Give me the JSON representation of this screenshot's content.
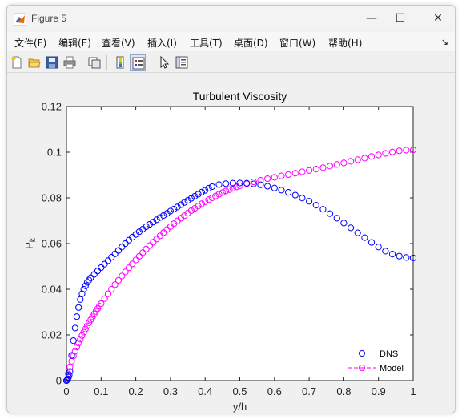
{
  "window": {
    "title": "Figure 5",
    "controls": {
      "minimize": "—",
      "maximize": "☐",
      "close": "✕"
    }
  },
  "menu": {
    "items": [
      "文件(F)",
      "编辑(E)",
      "查看(V)",
      "插入(I)",
      "工具(T)",
      "桌面(D)",
      "窗口(W)",
      "帮助(H)"
    ],
    "overflow_arrow": "↘"
  },
  "toolbar": {
    "icons": [
      "new-figure-icon",
      "open-file-icon",
      "save-icon",
      "print-icon",
      "link-plot-icon",
      "insert-colorbar-icon",
      "insert-legend-icon",
      "pointer-icon",
      "property-inspector-icon"
    ]
  },
  "colors": {
    "dns": "#0000ff",
    "model": "#ff00ff"
  },
  "chart_data": {
    "type": "scatter",
    "title": "Turbulent Viscosity",
    "xlabel": "y/h",
    "ylabel": "P",
    "ylabel_subscript": "k",
    "xlim": [
      0,
      1
    ],
    "ylim": [
      0,
      0.12
    ],
    "x_ticks": [
      "0",
      "0.1",
      "0.2",
      "0.3",
      "0.4",
      "0.5",
      "0.6",
      "0.7",
      "0.8",
      "0.9",
      "1"
    ],
    "y_ticks": [
      "0",
      "0.02",
      "0.04",
      "0.06",
      "0.08",
      "0.1",
      "0.12"
    ],
    "grid": false,
    "legend_position": "bottom-right",
    "series": [
      {
        "name": "DNS",
        "marker": "circle",
        "line": "none",
        "x": [
          0.0,
          0.002,
          0.004,
          0.006,
          0.008,
          0.01,
          0.015,
          0.02,
          0.025,
          0.03,
          0.035,
          0.04,
          0.045,
          0.05,
          0.055,
          0.06,
          0.065,
          0.07,
          0.08,
          0.09,
          0.1,
          0.11,
          0.12,
          0.13,
          0.14,
          0.15,
          0.16,
          0.17,
          0.18,
          0.19,
          0.2,
          0.21,
          0.22,
          0.23,
          0.24,
          0.25,
          0.26,
          0.27,
          0.28,
          0.29,
          0.3,
          0.31,
          0.32,
          0.33,
          0.34,
          0.35,
          0.36,
          0.37,
          0.38,
          0.39,
          0.4,
          0.41,
          0.42,
          0.44,
          0.46,
          0.48,
          0.5,
          0.52,
          0.54,
          0.56,
          0.58,
          0.6,
          0.62,
          0.64,
          0.66,
          0.68,
          0.7,
          0.72,
          0.74,
          0.76,
          0.78,
          0.8,
          0.82,
          0.84,
          0.86,
          0.88,
          0.9,
          0.92,
          0.94,
          0.96,
          0.98,
          1.0
        ],
        "y": [
          0.0,
          0.0003,
          0.0008,
          0.0015,
          0.0025,
          0.004,
          0.011,
          0.0175,
          0.023,
          0.028,
          0.032,
          0.0355,
          0.038,
          0.04,
          0.0415,
          0.043,
          0.044,
          0.045,
          0.0465,
          0.048,
          0.0495,
          0.051,
          0.0525,
          0.054,
          0.0555,
          0.057,
          0.0585,
          0.06,
          0.0615,
          0.0628,
          0.064,
          0.0652,
          0.0663,
          0.0674,
          0.0684,
          0.0694,
          0.0704,
          0.0714,
          0.0723,
          0.0732,
          0.0742,
          0.0751,
          0.076,
          0.077,
          0.078,
          0.0789,
          0.0798,
          0.0807,
          0.0816,
          0.0825,
          0.0833,
          0.0842,
          0.0849,
          0.0858,
          0.0862,
          0.0864,
          0.0865,
          0.0864,
          0.0861,
          0.0857,
          0.0851,
          0.0843,
          0.0834,
          0.0824,
          0.0812,
          0.0799,
          0.0785,
          0.0768,
          0.075,
          0.0731,
          0.0711,
          0.069,
          0.0669,
          0.0647,
          0.0626,
          0.0605,
          0.0585,
          0.0567,
          0.0554,
          0.0545,
          0.0539,
          0.0537
        ]
      },
      {
        "name": "Model",
        "marker": "circle",
        "line": "dashed",
        "x": [
          0.0,
          0.005,
          0.01,
          0.015,
          0.02,
          0.025,
          0.03,
          0.035,
          0.04,
          0.045,
          0.05,
          0.055,
          0.06,
          0.065,
          0.07,
          0.075,
          0.08,
          0.085,
          0.09,
          0.095,
          0.1,
          0.11,
          0.12,
          0.13,
          0.14,
          0.15,
          0.16,
          0.17,
          0.18,
          0.19,
          0.2,
          0.21,
          0.22,
          0.23,
          0.24,
          0.25,
          0.26,
          0.27,
          0.28,
          0.29,
          0.3,
          0.31,
          0.32,
          0.33,
          0.34,
          0.35,
          0.36,
          0.37,
          0.38,
          0.39,
          0.4,
          0.41,
          0.42,
          0.43,
          0.44,
          0.45,
          0.46,
          0.47,
          0.48,
          0.49,
          0.5,
          0.52,
          0.54,
          0.56,
          0.58,
          0.6,
          0.62,
          0.64,
          0.66,
          0.68,
          0.7,
          0.72,
          0.74,
          0.76,
          0.78,
          0.8,
          0.82,
          0.84,
          0.86,
          0.88,
          0.9,
          0.92,
          0.94,
          0.96,
          0.98,
          1.0
        ],
        "y": [
          0.0,
          0.003,
          0.006,
          0.0085,
          0.0108,
          0.0128,
          0.0147,
          0.0164,
          0.0181,
          0.0197,
          0.0212,
          0.0226,
          0.024,
          0.0253,
          0.0266,
          0.0279,
          0.0291,
          0.0303,
          0.0315,
          0.0326,
          0.0337,
          0.0359,
          0.038,
          0.04,
          0.042,
          0.0439,
          0.0458,
          0.0476,
          0.0494,
          0.0511,
          0.0528,
          0.0544,
          0.056,
          0.0576,
          0.0591,
          0.0606,
          0.062,
          0.0634,
          0.0648,
          0.0661,
          0.0674,
          0.0687,
          0.0699,
          0.0711,
          0.0722,
          0.0733,
          0.0744,
          0.0754,
          0.0764,
          0.0774,
          0.0783,
          0.0792,
          0.08,
          0.0808,
          0.0816,
          0.0823,
          0.083,
          0.0836,
          0.0842,
          0.0848,
          0.0853,
          0.0862,
          0.087,
          0.0877,
          0.0884,
          0.089,
          0.0896,
          0.0902,
          0.0908,
          0.0914,
          0.092,
          0.0926,
          0.0932,
          0.0939,
          0.0946,
          0.0953,
          0.096,
          0.0967,
          0.0974,
          0.0981,
          0.0988,
          0.0995,
          0.1001,
          0.1006,
          0.1009,
          0.101
        ]
      }
    ]
  }
}
